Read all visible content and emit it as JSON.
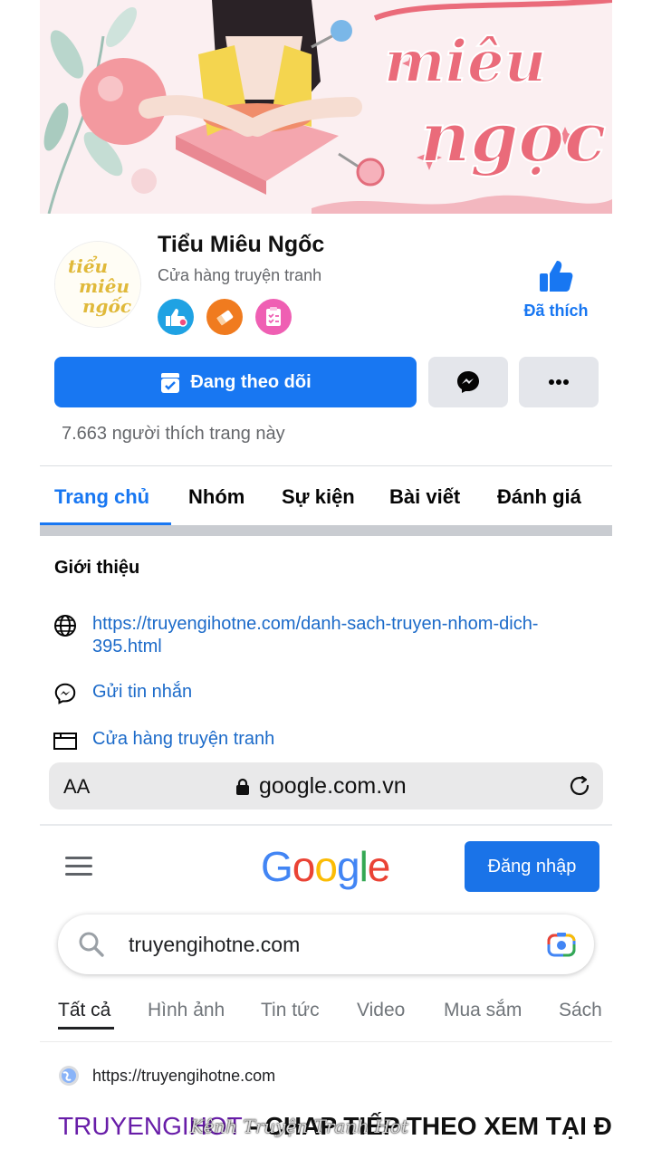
{
  "cover": {
    "artwork_text_line1": "miêu",
    "artwork_text_line2": "ngọc"
  },
  "page": {
    "name": "Tiểu Miêu Ngốc",
    "category": "Cửa hàng truyện tranh",
    "avatar_text_line1": "tiểu",
    "avatar_text_line2": "miêu",
    "avatar_text_line3": "ngốc",
    "liked_label": "Đã thích",
    "follow_label": "Đang theo dõi",
    "likes_count": "7.663 người thích trang này",
    "accent_color": "#1877f2"
  },
  "tabs": [
    "Trang chủ",
    "Nhóm",
    "Sự kiện",
    "Bài viết",
    "Đánh giá"
  ],
  "intro": {
    "title": "Giới thiệu",
    "website": "https://truyengihotne.com/danh-sach-truyen-nhom-dich-395.html",
    "message": "Gửi tin nhắn",
    "category": "Cửa hàng truyện tranh"
  },
  "browser": {
    "text_size": "AA",
    "url": "google.com.vn"
  },
  "google": {
    "logo_letters": [
      "G",
      "o",
      "o",
      "g",
      "l",
      "e"
    ],
    "logo_colors": [
      "#4285f4",
      "#ea4335",
      "#fbbc05",
      "#4285f4",
      "#34a853",
      "#ea4335"
    ],
    "signin_label": "Đăng nhập",
    "query": "truyengihotne.com",
    "tabs": [
      "Tất cả",
      "Hình ảnh",
      "Tin tức",
      "Video",
      "Mua sắm",
      "Sách"
    ],
    "result": {
      "url": "https://truyengihotne.com",
      "title_purple": "TRUYENGIHOT",
      "title_black": " - CHAP TIẾP THEO XEM TẠI ĐÂY NHA",
      "watermark": "Kênh Truyện Tranh Hot"
    }
  }
}
